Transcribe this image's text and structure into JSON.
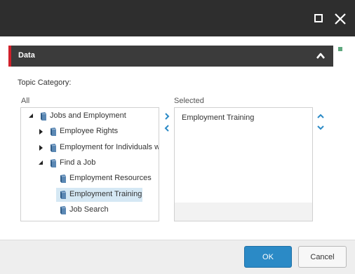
{
  "window": {
    "maximize_icon": "maximize-icon",
    "close_icon": "close-icon",
    "titlebar_color": "#2e2e2e"
  },
  "section": {
    "title": "Data",
    "collapse_icon": "chevron-up-icon",
    "accent_color": "#d0202a",
    "status_color": "#5fa87e"
  },
  "topic": {
    "label": "Topic Category:",
    "all_label": "All",
    "selected_label": "Selected"
  },
  "tree": [
    {
      "label": "Jobs and Employment",
      "level": 0,
      "toggle": "expanded"
    },
    {
      "label": "Employee Rights",
      "level": 1,
      "toggle": "collapsed"
    },
    {
      "label": "Employment for Individuals with Disabilities",
      "level": 1,
      "toggle": "collapsed"
    },
    {
      "label": "Find a Job",
      "level": 1,
      "toggle": "expanded"
    },
    {
      "label": "Employment Resources",
      "level": 2,
      "toggle": "none"
    },
    {
      "label": "Employment Training",
      "level": 2,
      "toggle": "none",
      "selected": true
    },
    {
      "label": "Job Search",
      "level": 2,
      "toggle": "none"
    }
  ],
  "selected_items": [
    "Employment Training"
  ],
  "move": {
    "add_icon": "chevron-right-icon",
    "remove_icon": "chevron-left-icon",
    "up_icon": "chevron-up-icon",
    "down_icon": "chevron-down-icon",
    "icon_color": "#2b8ac6"
  },
  "footer": {
    "ok_label": "OK",
    "cancel_label": "Cancel",
    "ok_color": "#2b8ac6"
  }
}
